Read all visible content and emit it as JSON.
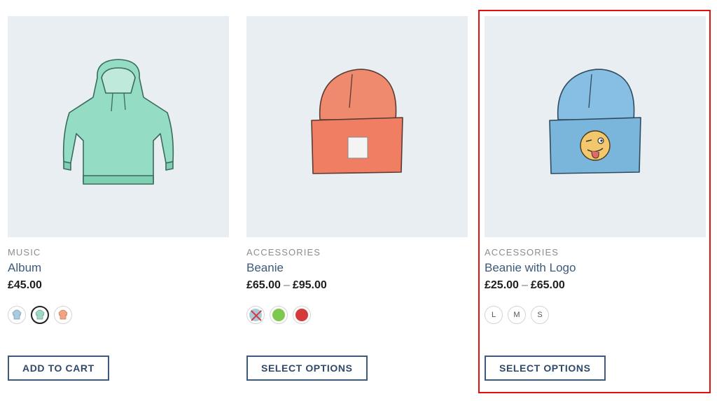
{
  "products": [
    {
      "category": "MUSIC",
      "name": "Album",
      "price": "£45.00",
      "button_label": "ADD TO CART",
      "swatches": [
        {
          "icon": "hoodie-blue-icon",
          "color": "#a9cbe0",
          "selected": false
        },
        {
          "icon": "hoodie-green-icon",
          "color": "#9fd9c6",
          "selected": true
        },
        {
          "icon": "hoodie-orange-icon",
          "color": "#f2a585",
          "selected": false
        }
      ]
    },
    {
      "category": "ACCESSORIES",
      "name": "Beanie",
      "price_low": "£65.00",
      "price_separator": "–",
      "price_high": "£95.00",
      "button_label": "SELECT OPTIONS",
      "swatches": [
        {
          "color": "#a9cbe0",
          "disabled": true
        },
        {
          "color": "#7ec850"
        },
        {
          "color": "#d43a3a"
        }
      ]
    },
    {
      "category": "ACCESSORIES",
      "name": "Beanie with Logo",
      "price_low": "£25.00",
      "price_separator": "–",
      "price_high": "£65.00",
      "button_label": "SELECT OPTIONS",
      "sizes": [
        "L",
        "M",
        "S"
      ]
    }
  ],
  "colors": {
    "accent": "#3c5a7c",
    "image_bg": "#e9eef3",
    "highlight": "#e01010",
    "hoodie": "#94dcc4",
    "beanie_orange": "#ef8a6e",
    "beanie_blue": "#86bfe3"
  }
}
